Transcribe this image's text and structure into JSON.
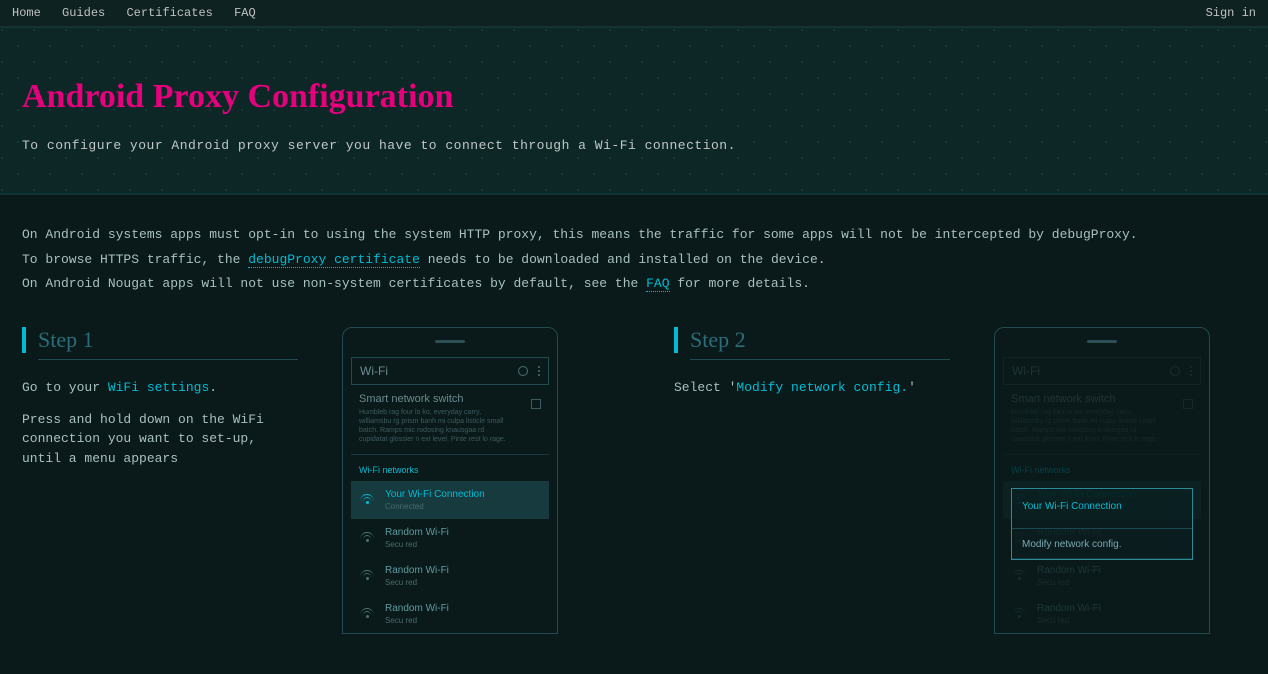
{
  "nav": {
    "items": [
      "Home",
      "Guides",
      "Certificates",
      "FAQ"
    ],
    "signin": "Sign in"
  },
  "hero": {
    "title": "Android Proxy Configuration",
    "subtitle": "To configure your Android proxy server you have to connect through a Wi-Fi connection."
  },
  "intro": {
    "line1": "On Android systems apps must opt-in to using the system HTTP proxy, this means the traffic for some apps will not be intercepted by debugProxy.",
    "line2_a": "To browse HTTPS traffic, the ",
    "line2_link": "debugProxy certificate",
    "line2_b": " needs to be downloaded and installed on the device.",
    "line3_a": "On Android Nougat apps will not use non-system certificates by default, see the ",
    "line3_link": "FAQ",
    "line3_b": " for more details."
  },
  "step1": {
    "heading": "Step 1",
    "p1_a": "Go to your ",
    "p1_hl": "WiFi settings",
    "p1_b": ".",
    "p2": "Press and hold down on the WiFi connection you want to set-up, until a menu appears"
  },
  "step2": {
    "heading": "Step 2",
    "p1_a": "Select '",
    "p1_hl": "Modify network config.",
    "p1_b": "'"
  },
  "phone": {
    "wifi_title": "Wi-Fi",
    "smart_title": "Smart network switch",
    "smart_desc": "Humbleb rag four lo ko, everyday carry, williamsbu rg prism banh mi culpa listicle small batch. Ramps mic rodosing knausgaa rd cupidatat glossier n ext level. Pinte rest lo rage.",
    "section": "Wi-Fi networks",
    "net_sel_name": "Your Wi-Fi Connection",
    "net_sel_status": "Connected",
    "net_other_name": "Random Wi-Fi",
    "net_other_status": "Secu red"
  },
  "overlay": {
    "title": "Your Wi-Fi Connection",
    "item": "Modify network config."
  }
}
